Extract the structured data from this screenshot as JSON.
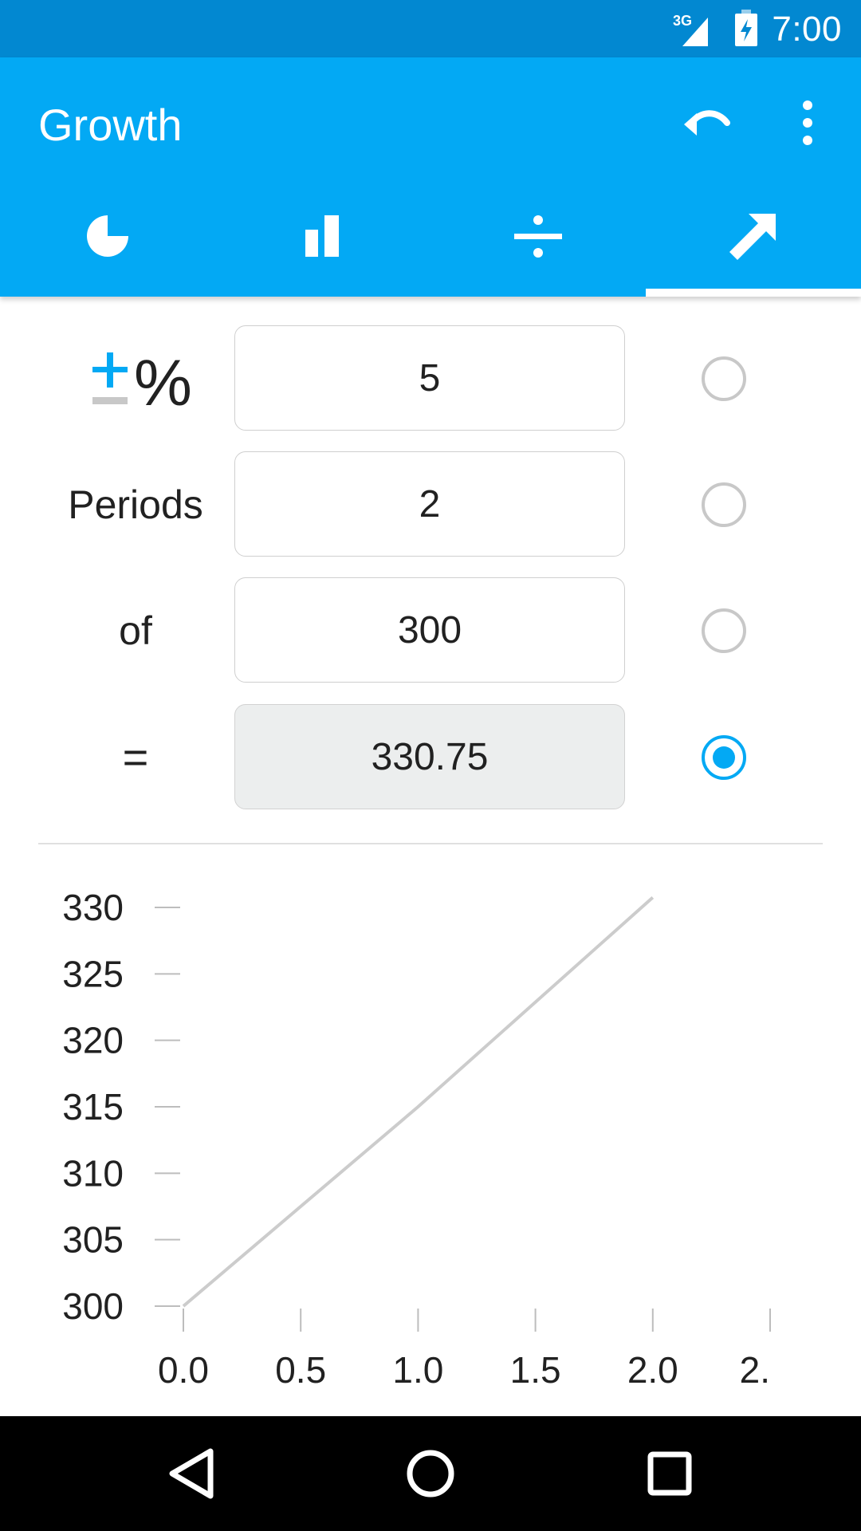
{
  "status_bar": {
    "time": "7:00",
    "network": "3G"
  },
  "app_bar": {
    "title": "Growth",
    "actions": [
      {
        "icon": "undo-icon"
      },
      {
        "icon": "more-vert-icon"
      }
    ]
  },
  "tabs": [
    {
      "icon": "pie-chart-icon",
      "selected": false
    },
    {
      "icon": "bar-chart-icon",
      "selected": false
    },
    {
      "icon": "divide-icon",
      "selected": false
    },
    {
      "icon": "trending-up-arrow-icon",
      "selected": true
    }
  ],
  "form": {
    "rows": [
      {
        "label": "",
        "label_icon": "plus-minus-percent-icon",
        "value": "5",
        "selected": false
      },
      {
        "label": "Periods",
        "value": "2",
        "selected": false
      },
      {
        "label": "of",
        "value": "300",
        "selected": false
      },
      {
        "label": "=",
        "value": "330.75",
        "selected": true
      }
    ]
  },
  "chart_data": {
    "type": "line",
    "x": [
      0,
      1,
      2
    ],
    "series": [
      {
        "values": [
          300,
          315,
          330.75
        ]
      }
    ],
    "y_ticks": [
      "300",
      "305",
      "310",
      "315",
      "320",
      "325",
      "330"
    ],
    "x_ticks": [
      "0.0",
      "0.5",
      "1.0",
      "1.5",
      "2.0",
      "2."
    ],
    "ylim": [
      300,
      330
    ],
    "xlim": [
      0,
      2.5
    ],
    "grid": false
  },
  "nav_bar": {
    "buttons": [
      "back-icon",
      "home-icon",
      "recents-icon"
    ]
  },
  "colors": {
    "primary": "#03a9f4",
    "primary_dark": "#0288d1",
    "line": "#cccccc"
  }
}
